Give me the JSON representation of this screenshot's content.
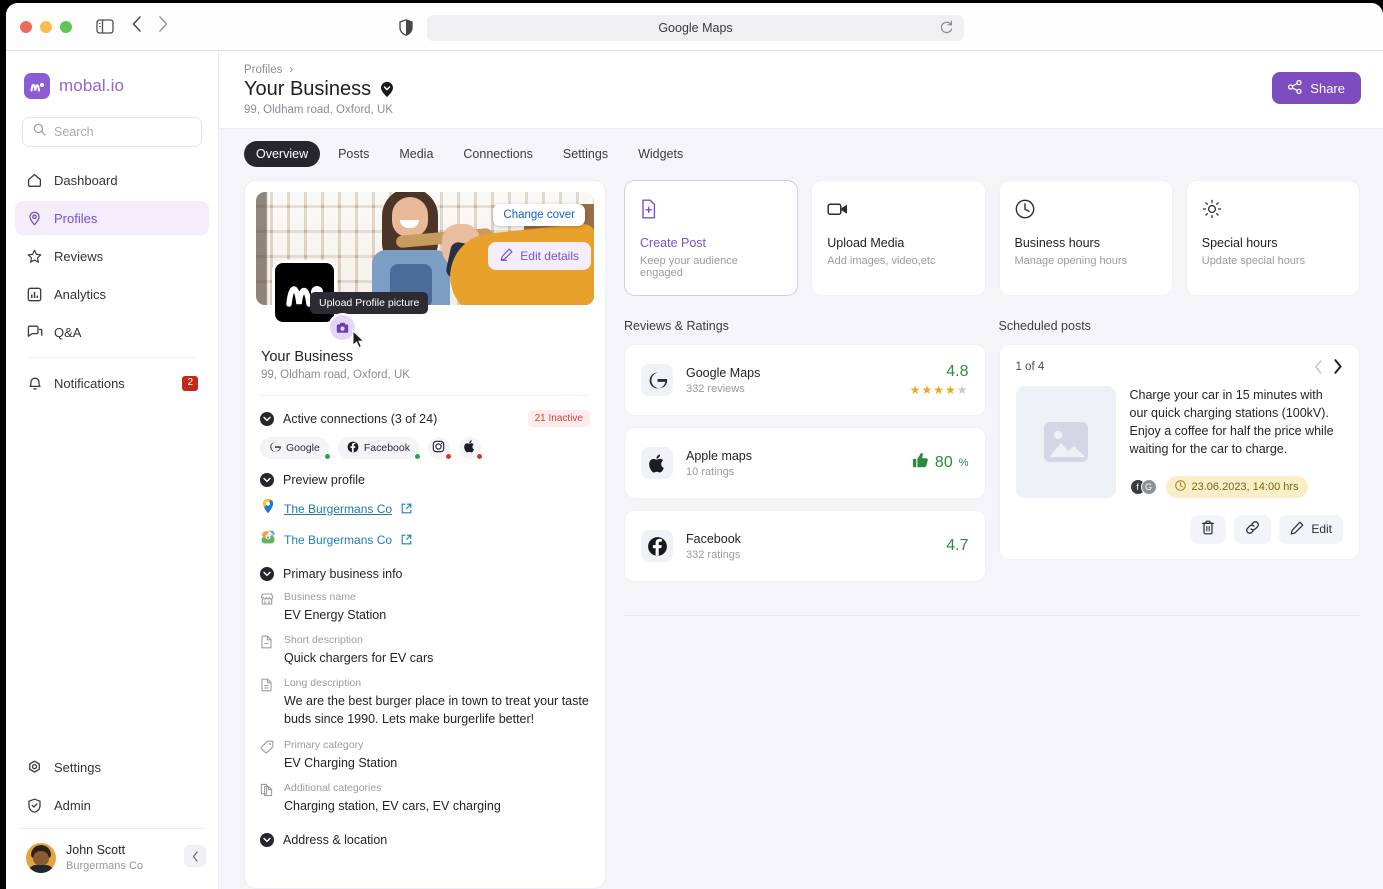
{
  "browser": {
    "url_title": "Google Maps",
    "reload_icon": "reload-icon",
    "shield_icon": "shield-icon",
    "back_icon": "chevron-left-icon",
    "forward_icon": "chevron-right-icon",
    "sidebar_icon": "sidebar-toggle-icon"
  },
  "sidebar": {
    "brand": "mobal.io",
    "search_placeholder": "Search",
    "search_value": "",
    "items": [
      {
        "label": "Dashboard",
        "icon": "home-icon",
        "active": false
      },
      {
        "label": "Profiles",
        "icon": "pin-icon",
        "active": true
      },
      {
        "label": "Reviews",
        "icon": "star-icon",
        "active": false
      },
      {
        "label": "Analytics",
        "icon": "bar-chart-icon",
        "active": false
      },
      {
        "label": "Q&A",
        "icon": "chat-icon",
        "active": false
      },
      {
        "label": "Notifications",
        "icon": "bell-icon",
        "active": false,
        "badge": "2"
      }
    ],
    "bottom_items": [
      {
        "label": "Settings",
        "icon": "gear-icon"
      },
      {
        "label": "Admin",
        "icon": "shield-check-icon"
      }
    ],
    "user": {
      "name": "John Scott",
      "company": "Burgermans Co"
    },
    "collapse_icon": "chevron-left-icon"
  },
  "header": {
    "breadcrumb": "Profiles",
    "breadcrumb_sep": "›",
    "title": "Your Business",
    "subtitle": "99, Oldham road, Oxford, UK",
    "share_label": "Share",
    "share_color": "#7d4dc0"
  },
  "tabs": [
    {
      "label": "Overview",
      "active": true
    },
    {
      "label": "Posts",
      "active": false
    },
    {
      "label": "Media",
      "active": false
    },
    {
      "label": "Connections",
      "active": false
    },
    {
      "label": "Settings",
      "active": false
    },
    {
      "label": "Widgets",
      "active": false
    }
  ],
  "profile_card": {
    "change_cover_label": "Change cover",
    "upload_tooltip": "Upload Profile picture",
    "name": "Your Business",
    "address": "99, Oldham road, Oxford, UK",
    "edit_details_label": "Edit details",
    "connections": {
      "title": "Active connections (3 of 24)",
      "inactive_badge": "21 Inactive",
      "chips": [
        {
          "label": "Google",
          "icon": "google-icon",
          "status": "ok"
        },
        {
          "label": "Facebook",
          "icon": "facebook-icon",
          "status": "ok"
        },
        {
          "label": "",
          "icon": "instagram-icon",
          "status": "bad"
        },
        {
          "label": "",
          "icon": "apple-icon",
          "status": "bad"
        }
      ]
    },
    "preview": {
      "title": "Preview profile",
      "links": [
        {
          "text": "The Burgermans Co",
          "icon": "google-maps-pin-icon",
          "underline": true
        },
        {
          "text": "The Burgermans Co",
          "icon": "apple-maps-icon",
          "underline": false
        }
      ]
    },
    "primary_info": {
      "title": "Primary business info",
      "fields": [
        {
          "label": "Business name",
          "value": "EV Energy Station",
          "icon": "store-icon"
        },
        {
          "label": "Short description",
          "value": "Quick chargers for EV cars",
          "icon": "doc-minus-icon"
        },
        {
          "label": "Long description",
          "value": "We are the best burger place in town to treat your taste buds since 1990. Lets make burgerlife better!",
          "icon": "doc-lines-icon"
        },
        {
          "label": "Primary category",
          "value": "EV Charging Station",
          "icon": "tag-icon"
        },
        {
          "label": "Additional categories",
          "value": "Charging station, EV cars, EV charging",
          "icon": "copy-icon"
        }
      ]
    },
    "address_section_title": "Address & location"
  },
  "action_cards": [
    {
      "title": "Create Post",
      "sub": "Keep your audience engaged",
      "icon": "file-plus-icon",
      "highlight": true
    },
    {
      "title": "Upload Media",
      "sub": "Add images, video,etc",
      "icon": "video-icon",
      "highlight": false
    },
    {
      "title": "Business hours",
      "sub": "Manage opening hours",
      "icon": "clock-icon",
      "highlight": false
    },
    {
      "title": "Special hours",
      "sub": "Update special hours",
      "icon": "sun-icon",
      "highlight": false
    }
  ],
  "reviews": {
    "title": "Reviews & Ratings",
    "items": [
      {
        "name": "Google Maps",
        "sub": "332 reviews",
        "score": "4.8",
        "type": "stars",
        "stars_on": 4,
        "stars_off": 1,
        "icon": "google-icon"
      },
      {
        "name": "Apple maps",
        "sub": "10 ratings",
        "score": "80",
        "score_suffix": "%",
        "type": "thumb",
        "icon": "apple-icon"
      },
      {
        "name": "Facebook",
        "sub": "332 ratings",
        "score": "4.7",
        "type": "plain",
        "icon": "facebook-icon"
      }
    ],
    "score_color": "#2d8a3d"
  },
  "scheduled": {
    "title": "Scheduled posts",
    "counter": "1 of 4",
    "prev_icon": "chevron-left-icon",
    "next_icon": "chevron-right-icon",
    "post_text": "Charge your car in 15 minutes with our quick charging stations (100kV). Enjoy a coffee for half the price while waiting for the car to charge.",
    "networks": [
      "facebook-icon",
      "google-icon"
    ],
    "schedule_time": "23.06.2023, 14:00 hrs",
    "time_icon": "clock-icon",
    "actions": [
      {
        "label": "",
        "icon": "trash-icon"
      },
      {
        "label": "",
        "icon": "link-icon"
      },
      {
        "label": "Edit",
        "icon": "pencil-icon"
      }
    ]
  }
}
